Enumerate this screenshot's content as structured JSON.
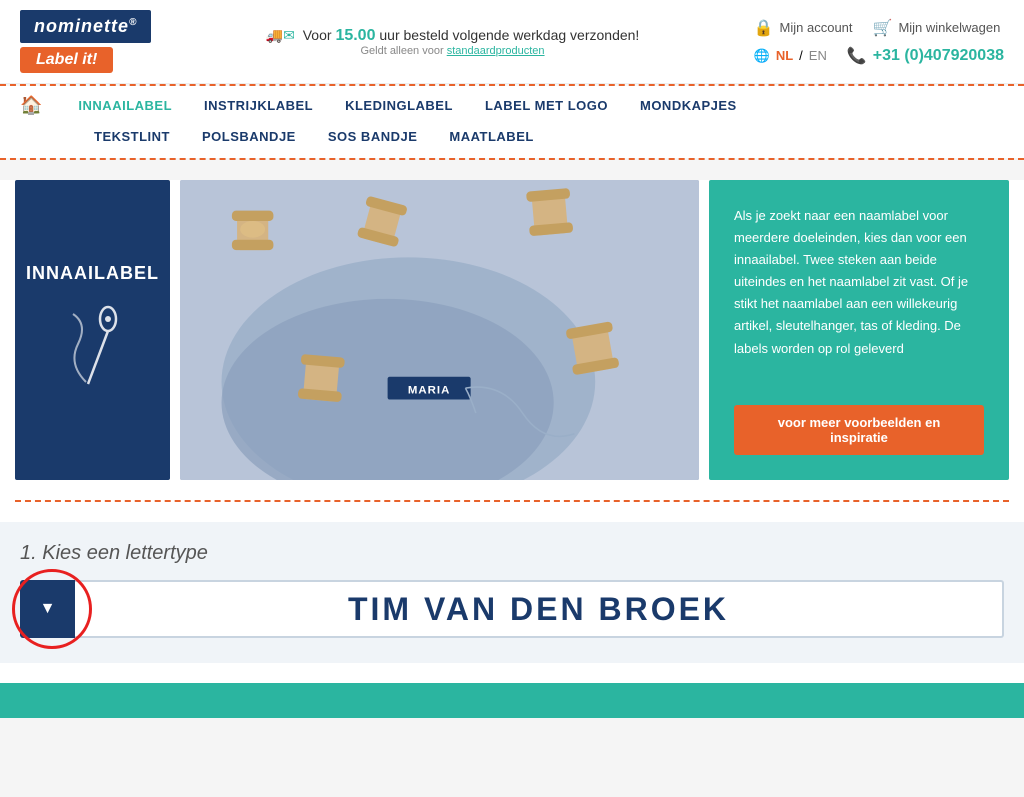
{
  "logo": {
    "brand": "nominette",
    "registered": "®",
    "tagline": "Label it!"
  },
  "header": {
    "shipping_prefix": "Voor ",
    "shipping_time": "15.00",
    "shipping_suffix": "uur besteld volgende werkdag verzonden!",
    "shipping_sub": "Geldt alleen voor ",
    "shipping_link": "standaardproducten",
    "account_icon": "🔒",
    "account_label": "Mijn account",
    "cart_icon": "🛒",
    "cart_label": "Mijn winkelwagen",
    "globe_icon": "🌐",
    "lang_nl": "NL",
    "lang_sep": " / ",
    "lang_en": "EN",
    "phone_icon": "📞",
    "phone": "+31 (0)407920038"
  },
  "nav": {
    "home_icon": "🏠",
    "items": [
      {
        "label": "INNAAILABEL",
        "active": true
      },
      {
        "label": "INSTRIJKLABEL",
        "active": false
      },
      {
        "label": "KLEDINGLABEL",
        "active": false
      },
      {
        "label": "LABEL MET LOGO",
        "active": false
      },
      {
        "label": "MONDKAPJES",
        "active": false
      },
      {
        "label": "TEKSTLINT",
        "active": false
      },
      {
        "label": "POLSBANDJE",
        "active": false
      },
      {
        "label": "SOS BANDJE",
        "active": false
      },
      {
        "label": "MAATLABEL",
        "active": false
      }
    ]
  },
  "hero": {
    "blue_title": "INNAAILABEL",
    "needle_char": "🧵",
    "label_name": "MARIA",
    "text_body": "Als je zoekt naar een naamlabel voor meerdere doeleinden, kies dan voor een innaailabel. Twee steken aan beide uiteindes en het naamlabel zit vast. Of je stikt het naamlabel aan een willekeurig artikel, sleutelhanger, tas of kleding.\nDe labels worden op rol geleverd",
    "btn_label": "voor meer voorbeelden en inspiratie"
  },
  "font_section": {
    "title": "1. Kies een lettertype",
    "dropdown_arrow": "▼",
    "preview_text": "Tim van den Broek"
  }
}
